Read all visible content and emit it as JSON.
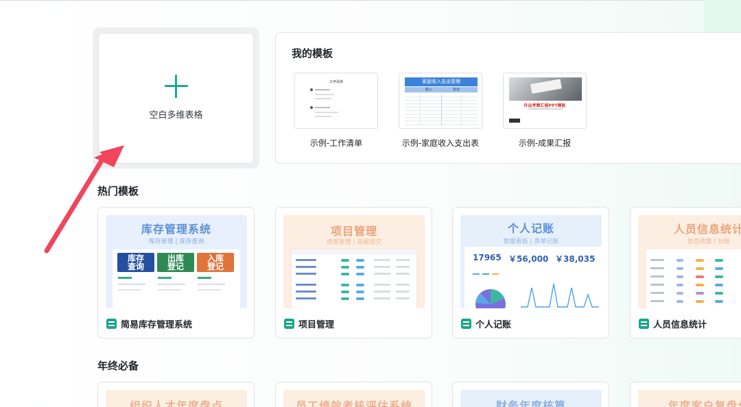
{
  "blank": {
    "label": "空白多维表格"
  },
  "my_templates": {
    "title": "我的模板",
    "items": [
      {
        "label": "示例-工作清单",
        "thumb_title": "工作清单"
      },
      {
        "label": "示例-家庭收入支出表",
        "thumb_title": "家庭收入支出管理",
        "thumb_income": "收入",
        "thumb_expense": "支出"
      },
      {
        "label": "示例-成果汇报",
        "thumb_title": "外出考察汇报PPT模板"
      }
    ]
  },
  "hot": {
    "title": "热门模板",
    "items": [
      {
        "name": "简易库存管理系统",
        "preview_title": "库存管理系统",
        "preview_sub": "库存管理 | 库存查询",
        "tiles": [
          "库存\n查询",
          "出库\n登记",
          "入库\n登记"
        ]
      },
      {
        "name": "项目管理",
        "preview_title": "项目管理",
        "preview_sub": "进度管理 | 周报提交"
      },
      {
        "name": "个人记账",
        "preview_title": "个人记账",
        "preview_sub": "数据看板 | 表单记账",
        "stats": [
          "17965",
          "￥56,000",
          "￥38,035"
        ]
      },
      {
        "name": "人员信息统计",
        "preview_title": "人员信息统计",
        "preview_sub": "信息收集 | 台账"
      }
    ]
  },
  "year_end": {
    "title": "年终必备",
    "items": [
      {
        "preview_title": "组织人才年度盘点"
      },
      {
        "preview_title": "员工绩效考核评估系统"
      },
      {
        "preview_title": "财务年度核算"
      },
      {
        "preview_title": "年度客户复盘分"
      }
    ]
  }
}
